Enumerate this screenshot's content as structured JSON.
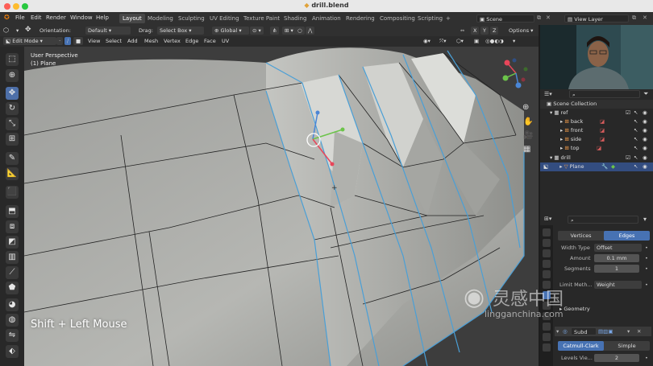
{
  "window": {
    "title": "drill.blend"
  },
  "menu": {
    "items": [
      "File",
      "Edit",
      "Render",
      "Window",
      "Help"
    ],
    "workspaces": [
      "Layout",
      "Modeling",
      "Sculpting",
      "UV Editing",
      "Texture Paint",
      "Shading",
      "Animation",
      "Rendering",
      "Compositing",
      "Scripting"
    ],
    "add_tab": "+",
    "scene": "Scene",
    "view_layer": "View Layer"
  },
  "header1": {
    "orientation_label": "Orientation:",
    "orientation_value": "Default",
    "drag_label": "Drag:",
    "drag_value": "Select Box",
    "transform_value": "Global",
    "axes": [
      "X",
      "Y",
      "Z"
    ],
    "options": "Options"
  },
  "header2": {
    "mode": "Edit Mode",
    "menus": [
      "View",
      "Select",
      "Add",
      "Mesh",
      "Vertex",
      "Edge",
      "Face",
      "UV"
    ]
  },
  "viewport": {
    "perspective": "User Perspective",
    "object": "(1) Plane",
    "overlay_hint": "Shift + Left Mouse"
  },
  "outliner": {
    "root": "Scene Collection",
    "items": [
      {
        "name": "ref",
        "indent": 1
      },
      {
        "name": "back",
        "indent": 2
      },
      {
        "name": "front",
        "indent": 2
      },
      {
        "name": "side",
        "indent": 2
      },
      {
        "name": "top",
        "indent": 2
      },
      {
        "name": "drill",
        "indent": 1
      },
      {
        "name": "Plane",
        "indent": 2
      }
    ]
  },
  "properties": {
    "tabs": [
      "Vertices",
      "Edges"
    ],
    "width_type_label": "Width Type",
    "width_type_value": "Offset",
    "amount_label": "Amount",
    "amount_value": "0.1 mm",
    "segments_label": "Segments",
    "segments_value": "1",
    "limit_label": "Limit Meth...",
    "limit_value": "Weight",
    "geometry_label": "Geometry",
    "subsurf_name": "Subd",
    "subsurf_modes": [
      "Catmull-Clark",
      "Simple"
    ],
    "levels_label": "Levels Vie...",
    "levels_value": "2"
  },
  "watermark": {
    "brand": "灵感中国",
    "url": "lingganchina.com"
  },
  "colors": {
    "accent": "#4772b3",
    "edge_select": "#4a9fd6",
    "mesh": "#a9aaa6"
  }
}
